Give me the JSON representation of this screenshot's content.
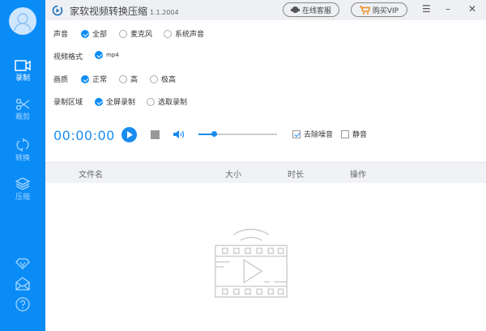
{
  "app": {
    "title": "家软视频转换压缩",
    "version": "1.1.2004"
  },
  "titlebar": {
    "service_label": "在线客服",
    "vip_label": "购买VIP",
    "menu_icon": "menu-icon",
    "minimize_icon": "minimize-icon",
    "close_icon": "close-icon"
  },
  "sidebar": {
    "items": [
      {
        "label": "录制",
        "icon": "video-camera-icon",
        "active": true
      },
      {
        "label": "裁剪",
        "icon": "scissors-icon"
      },
      {
        "label": "转换",
        "icon": "refresh-icon"
      },
      {
        "label": "压缩",
        "icon": "layers-icon"
      }
    ],
    "bottom_icons": [
      "vip-diamond-icon",
      "mail-icon",
      "help-icon"
    ]
  },
  "settings": {
    "audio": {
      "label": "声音",
      "options": [
        "全部",
        "麦克风",
        "系统声音"
      ],
      "selected": "全部"
    },
    "format": {
      "label": "视频格式",
      "options": [
        "mp4"
      ],
      "selected": "mp4"
    },
    "quality": {
      "label": "画质",
      "options": [
        "正常",
        "高",
        "极高"
      ],
      "selected": "正常"
    },
    "area": {
      "label": "录制区域",
      "options": [
        "全屏录制",
        "选取录制"
      ],
      "selected": "全屏录制"
    }
  },
  "player": {
    "time": "00:00:00",
    "volume": 0.2,
    "denoise_label": "去除噪音",
    "denoise": true,
    "mute_label": "静音",
    "mute": false
  },
  "table": {
    "columns": [
      "文件名",
      "大小",
      "时长",
      "操作"
    ],
    "rows": []
  },
  "colors": {
    "accent": "#0a8cf7"
  }
}
